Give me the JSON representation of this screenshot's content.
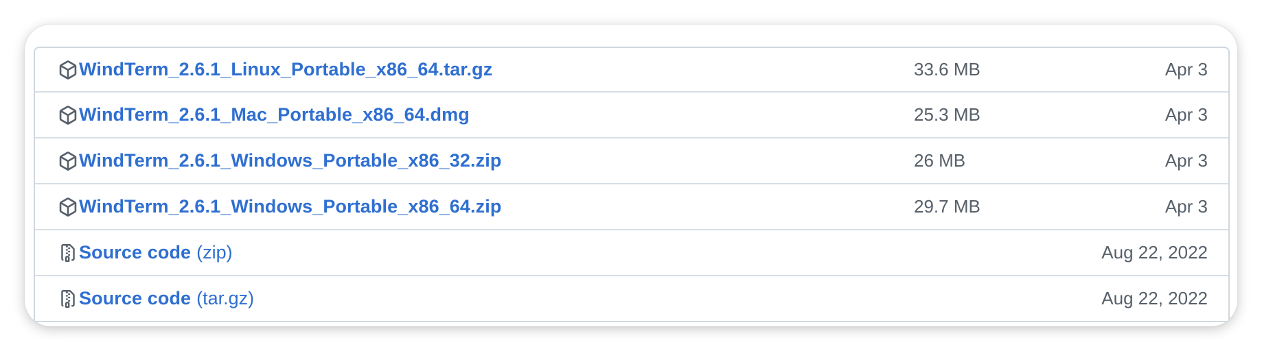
{
  "assets": [
    {
      "icon": "package-icon",
      "name": "WindTerm_2.6.1_Linux_Portable_x86_64.tar.gz",
      "size": "33.6 MB",
      "date": "Apr 3"
    },
    {
      "icon": "package-icon",
      "name": "WindTerm_2.6.1_Mac_Portable_x86_64.dmg",
      "size": "25.3 MB",
      "date": "Apr 3"
    },
    {
      "icon": "package-icon",
      "name": "WindTerm_2.6.1_Windows_Portable_x86_32.zip",
      "size": "26 MB",
      "date": "Apr 3"
    },
    {
      "icon": "package-icon",
      "name": "WindTerm_2.6.1_Windows_Portable_x86_64.zip",
      "size": "29.7 MB",
      "date": "Apr 3"
    }
  ],
  "source": [
    {
      "icon": "file-zip-icon",
      "label": "Source code",
      "suffix": "(zip)",
      "date": "Aug 22, 2022"
    },
    {
      "icon": "file-zip-icon",
      "label": "Source code",
      "suffix": "(tar.gz)",
      "date": "Aug 22, 2022"
    }
  ],
  "colors": {
    "link": "#2f6fd0",
    "muted": "#57606a",
    "border": "#d0d7de"
  }
}
